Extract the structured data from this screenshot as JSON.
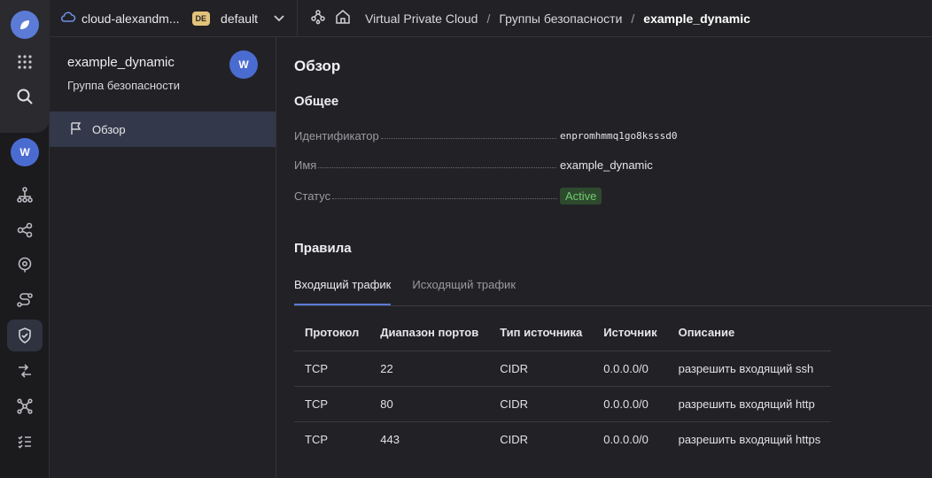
{
  "topbar": {
    "cloud_name": "cloud-alexandm...",
    "folder_badge": "DE",
    "folder_name": "default",
    "breadcrumbs": [
      "Virtual Private Cloud",
      "Группы безопасности",
      "example_dynamic"
    ]
  },
  "rail": {
    "icons": [
      "app-logo-icon",
      "grid-icon",
      "search-icon",
      "vpc-service-icon",
      "network-icon",
      "share-icon",
      "location-pin-icon",
      "route-icon",
      "shield-icon",
      "arrows-icon",
      "nodes-icon",
      "list-icon"
    ],
    "service_badge": "W"
  },
  "subnav": {
    "title": "example_dynamic",
    "subtitle": "Группа безопасности",
    "badge": "W",
    "items": [
      {
        "label": "Обзор",
        "icon": "flag-icon"
      }
    ]
  },
  "main": {
    "title": "Обзор",
    "general_heading": "Общее",
    "fields": {
      "id_label": "Идентификатор",
      "id_value": "enpromhmmq1go8ksssd0",
      "name_label": "Имя",
      "name_value": "example_dynamic",
      "status_label": "Статус",
      "status_value": "Active"
    },
    "rules_heading": "Правила",
    "tabs": [
      "Входящий трафик",
      "Исходящий трафик"
    ],
    "table": {
      "headers": [
        "Протокол",
        "Диапазон портов",
        "Тип источника",
        "Источник",
        "Описание"
      ],
      "rows": [
        [
          "TCP",
          "22",
          "CIDR",
          "0.0.0.0/0",
          "разрешить входящий ssh"
        ],
        [
          "TCP",
          "80",
          "CIDR",
          "0.0.0.0/0",
          "разрешить входящий http"
        ],
        [
          "TCP",
          "443",
          "CIDR",
          "0.0.0.0/0",
          "разрешить входящий https"
        ]
      ]
    }
  },
  "colors": {
    "accent": "#5b7bd6",
    "status_active_bg": "#2e4a2e",
    "status_active_text": "#6fca6f"
  }
}
